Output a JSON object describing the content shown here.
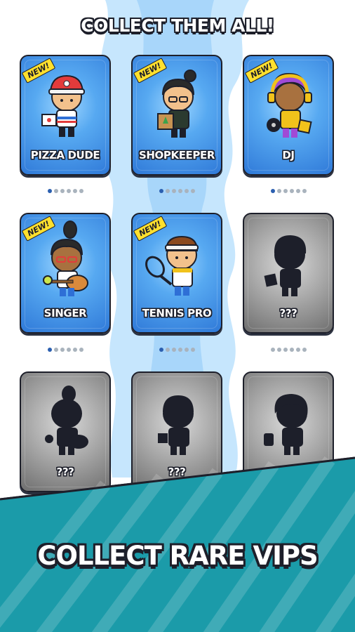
{
  "header": {
    "title": "COLLECT THEM ALL!"
  },
  "badge_text": "NEW!",
  "cards": [
    {
      "label": "PIZZA DUDE",
      "state": "unlocked",
      "new": true,
      "icon": "pizza-dude-character"
    },
    {
      "label": "SHOPKEEPER",
      "state": "unlocked",
      "new": true,
      "icon": "shopkeeper-character"
    },
    {
      "label": "DJ",
      "state": "unlocked",
      "new": true,
      "icon": "dj-character"
    },
    {
      "label": "SINGER",
      "state": "unlocked",
      "new": true,
      "icon": "singer-character"
    },
    {
      "label": "TENNIS PRO",
      "state": "unlocked",
      "new": true,
      "icon": "tennis-pro-character"
    },
    {
      "label": "???",
      "state": "locked",
      "new": false,
      "icon": "locked-silhouette"
    },
    {
      "label": "???",
      "state": "locked",
      "new": false,
      "icon": "locked-silhouette"
    },
    {
      "label": "???",
      "state": "locked",
      "new": false,
      "icon": "locked-silhouette"
    },
    {
      "label": "???",
      "state": "locked",
      "new": false,
      "icon": "locked-silhouette"
    }
  ],
  "pagination": {
    "total_dots": 6,
    "active_index": 0
  },
  "footer": {
    "banner_text": "COLLECT RARE VIPS"
  },
  "colors": {
    "card_blue": "#3b86e0",
    "card_gray": "#8c8c8c",
    "banner_teal": "#1b9ba9",
    "bg_light_blue": "#bfe2fb",
    "badge_yellow": "#ffe02e",
    "outline": "#1d1f2a"
  }
}
